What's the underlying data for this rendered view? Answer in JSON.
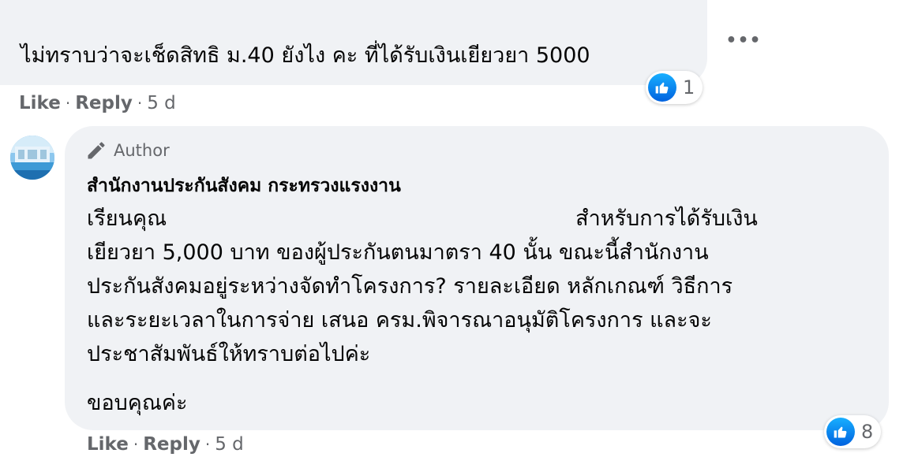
{
  "comment": {
    "text": "ไม่ทราบว่าจะเช็ดสิทธิ ม.40 ยังไง คะ ที่ได้รับเงินเยียวยา 5000",
    "like_count": "1",
    "like_label": "Like",
    "reply_label": "Reply",
    "time": "5 d"
  },
  "reply": {
    "badge": "Author",
    "page_name": "สำนักงานประกันสังคม กระทรวงแรงงาน",
    "line1_start": "เรียนคุณ",
    "line1_end": "สำหรับการได้รับเงิน",
    "line2": "เยียวยา 5,000 บาท ของผู้ประกันตนมาตรา 40 นั้น ขณะนี้สำนักงาน",
    "line3": "ประกันสังคมอยู่ระหว่างจัดทำโครงการ? รายละเอียด หลักเกณฑ์ วิธีการ",
    "line4": "และระยะเวลาในการจ่าย เสนอ ครม.พิจารณาอนุมัติโครงการ และจะ",
    "line5": "ประชาสัมพันธ์ให้ทราบต่อไปค่ะ",
    "closing": "ขอบคุณค่ะ",
    "like_count": "8",
    "like_label": "Like",
    "reply_label": "Reply",
    "time": "5 d"
  },
  "icons": {
    "more": "more-horizontal-icon",
    "like": "thumbs-up-icon",
    "author": "pen-icon"
  },
  "colors": {
    "bubble": "#f0f2f5",
    "secondary_text": "#65676b",
    "like_blue": "#0866ff"
  }
}
